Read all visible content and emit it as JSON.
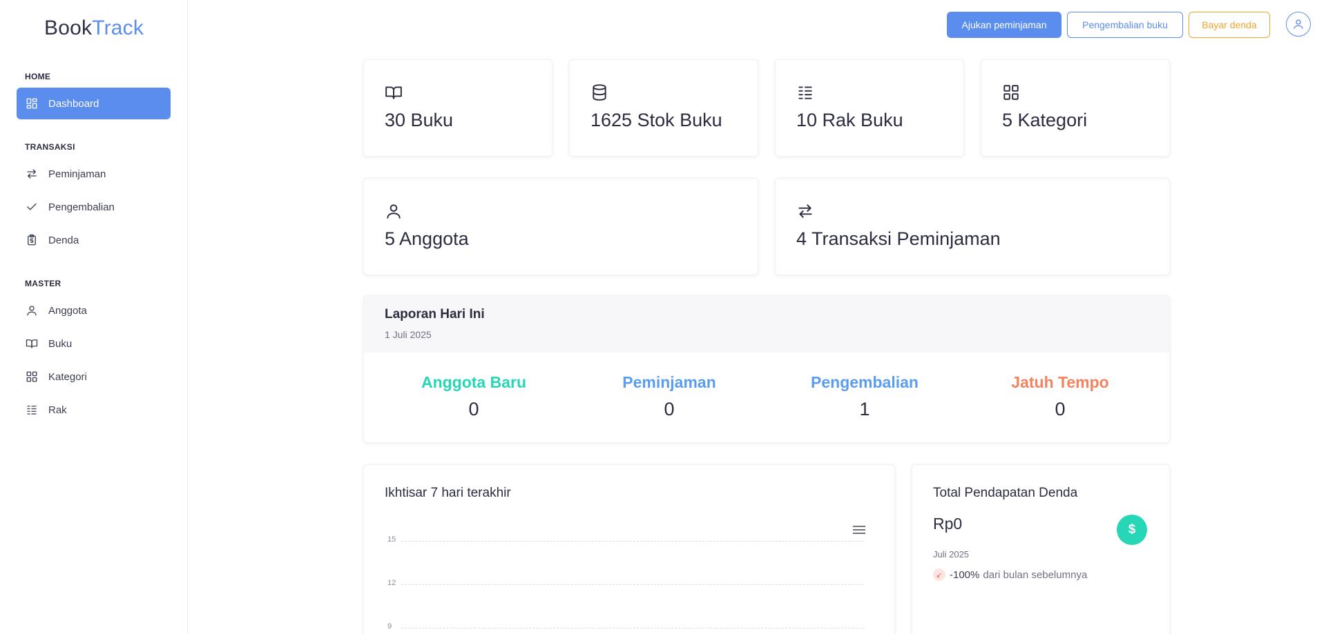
{
  "app": {
    "logo_main": "Book",
    "logo_accent": "Track",
    "accent_color": "#5a8dee"
  },
  "sidebar": {
    "sections": [
      {
        "label": "HOME"
      },
      {
        "label": "TRANSAKSI"
      },
      {
        "label": "MASTER"
      }
    ],
    "items": [
      {
        "label": "Dashboard",
        "icon": "dashboard-icon",
        "active": true
      },
      {
        "label": "Peminjaman",
        "icon": "swap-icon"
      },
      {
        "label": "Pengembalian",
        "icon": "check-icon"
      },
      {
        "label": "Denda",
        "icon": "clipboard-dollar-icon"
      },
      {
        "label": "Anggota",
        "icon": "user-icon"
      },
      {
        "label": "Buku",
        "icon": "book-icon"
      },
      {
        "label": "Kategori",
        "icon": "grid-icon"
      },
      {
        "label": "Rak",
        "icon": "list-icon"
      }
    ]
  },
  "header": {
    "btn_borrow": "Ajukan peminjaman",
    "btn_return": "Pengembalian buku",
    "btn_fine": "Bayar denda"
  },
  "stats": [
    {
      "text": "30 Buku",
      "icon": "book-icon"
    },
    {
      "text": "1625 Stok Buku",
      "icon": "database-icon"
    },
    {
      "text": "10 Rak Buku",
      "icon": "list-icon"
    },
    {
      "text": "5 Kategori",
      "icon": "grid-icon"
    },
    {
      "text": "5 Anggota",
      "icon": "user-icon"
    },
    {
      "text": "4 Transaksi Peminjaman",
      "icon": "swap-icon"
    }
  ],
  "report": {
    "title": "Laporan Hari Ini",
    "date": "1 Juli 2025",
    "metrics": [
      {
        "label": "Anggota Baru",
        "value": "0",
        "color": "#26d6b6"
      },
      {
        "label": "Peminjaman",
        "value": "0",
        "color": "#5a9dee"
      },
      {
        "label": "Pengembalian",
        "value": "1",
        "color": "#5a9dee"
      },
      {
        "label": "Jatuh Tempo",
        "value": "0",
        "color": "#f5825f"
      }
    ]
  },
  "overview": {
    "title": "Ikhtisar 7 hari terakhir",
    "ticks": [
      "15",
      "12",
      "9"
    ]
  },
  "revenue": {
    "title": "Total Pendapatan Denda",
    "amount": "Rp0",
    "period": "Juli 2025",
    "change_pct": "-100%",
    "change_text": "dari bulan sebelumnya",
    "badge": "$"
  }
}
